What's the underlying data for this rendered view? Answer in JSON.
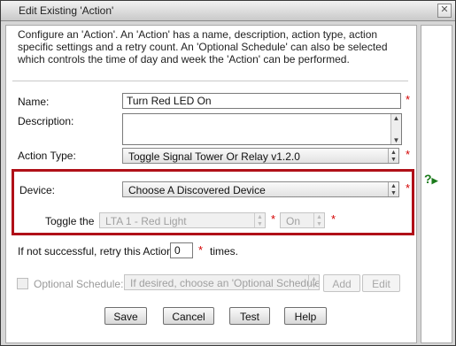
{
  "window": {
    "title": "Edit Existing 'Action'",
    "close_glyph": "✕"
  },
  "description": "Configure an 'Action'. An 'Action' has a name, description, action type, action specific settings and a retry count. An 'Optional Schedule' can also be selected which controls the time of day and week the 'Action' can be performed.",
  "required_marker": "*",
  "form": {
    "name_label": "Name:",
    "name_value": "Turn Red LED On",
    "description_label": "Description:",
    "description_value": "",
    "action_type_label": "Action Type:",
    "action_type_value": "Toggle Signal Tower Or Relay v1.2.0",
    "device_label": "Device:",
    "device_value": "Choose A Discovered Device",
    "toggle_label": "Toggle the",
    "toggle_target_value": "LTA 1 - Red Light",
    "toggle_state_value": "On",
    "retry_prefix": "If not successful, retry this Action",
    "retry_value": "0",
    "retry_suffix": "times.",
    "schedule_label": "Optional Schedule:",
    "schedule_placeholder": "If desired, choose an 'Optional Schedule'.",
    "schedule_add": "Add",
    "schedule_edit": "Edit"
  },
  "help_glyph": "?",
  "buttons": {
    "save": "Save",
    "cancel": "Cancel",
    "test": "Test",
    "help": "Help"
  },
  "colors": {
    "highlight_border": "#b01018",
    "required": "#d40000",
    "help_icon": "#1a7a1a"
  }
}
